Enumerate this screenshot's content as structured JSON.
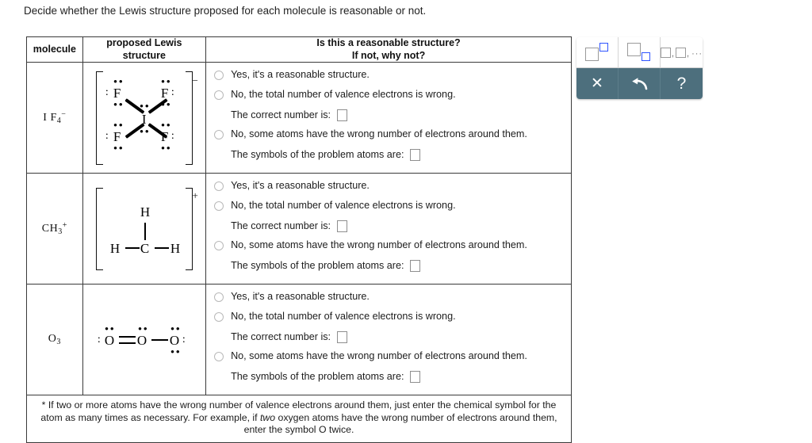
{
  "prompt": "Decide whether the Lewis structure proposed for each molecule is reasonable or not.",
  "table": {
    "headers": {
      "molecule": "molecule",
      "structure_line1": "proposed Lewis",
      "structure_line2": "structure",
      "answer_line1": "Is this a reasonable structure?",
      "answer_line2": "If not, why not?"
    },
    "options": {
      "yes": "Yes, it's a reasonable structure.",
      "no_valence": "No, the total number of valence electrons is wrong.",
      "correct_number_label": "The correct number is:",
      "no_atoms": "No, some atoms have the wrong number of electrons around them.",
      "problem_atoms_label": "The symbols of the problem atoms are:"
    },
    "rows": [
      {
        "molecule": {
          "formula": "I F",
          "sub": "4",
          "sup": "−"
        },
        "structure": {
          "name": "IF4-minus-lewis",
          "charge": "−",
          "center": "I",
          "ligands": [
            "F",
            "F",
            "F",
            "F"
          ]
        },
        "correct_number_value": "",
        "problem_atoms_value": "",
        "selected": ""
      },
      {
        "molecule": {
          "formula": "CH",
          "sub": "3",
          "sup": "+"
        },
        "structure": {
          "name": "CH3-plus-lewis",
          "charge": "+",
          "center": "C",
          "ligands": [
            "H",
            "H",
            "H"
          ]
        },
        "correct_number_value": "",
        "problem_atoms_value": "",
        "selected": ""
      },
      {
        "molecule": {
          "formula": "O",
          "sub": "3",
          "sup": ""
        },
        "structure": {
          "name": "O3-lewis",
          "charge": "",
          "center": "O",
          "ligands": [
            "O",
            "O"
          ]
        },
        "correct_number_value": "",
        "problem_atoms_value": "",
        "selected": ""
      }
    ],
    "footnote": {
      "part1": "* If two or more atoms have the wrong number of valence electrons around them, just enter the chemical symbol for the atom as many times as necessary. For example, if ",
      "emphasis": "two",
      "part2": " oxygen atoms have the wrong number of electrons around them, enter the symbol O twice."
    }
  },
  "toolbar": {
    "superscript_label": "superscript",
    "subscript_label": "subscript",
    "list_label": "list",
    "list_text": ", ",
    "list_dots": "···",
    "clear_label": "✕",
    "undo_label": "undo",
    "help_label": "?",
    "accent_color": "#4d6f7d",
    "highlight_color": "#2f54ff"
  }
}
